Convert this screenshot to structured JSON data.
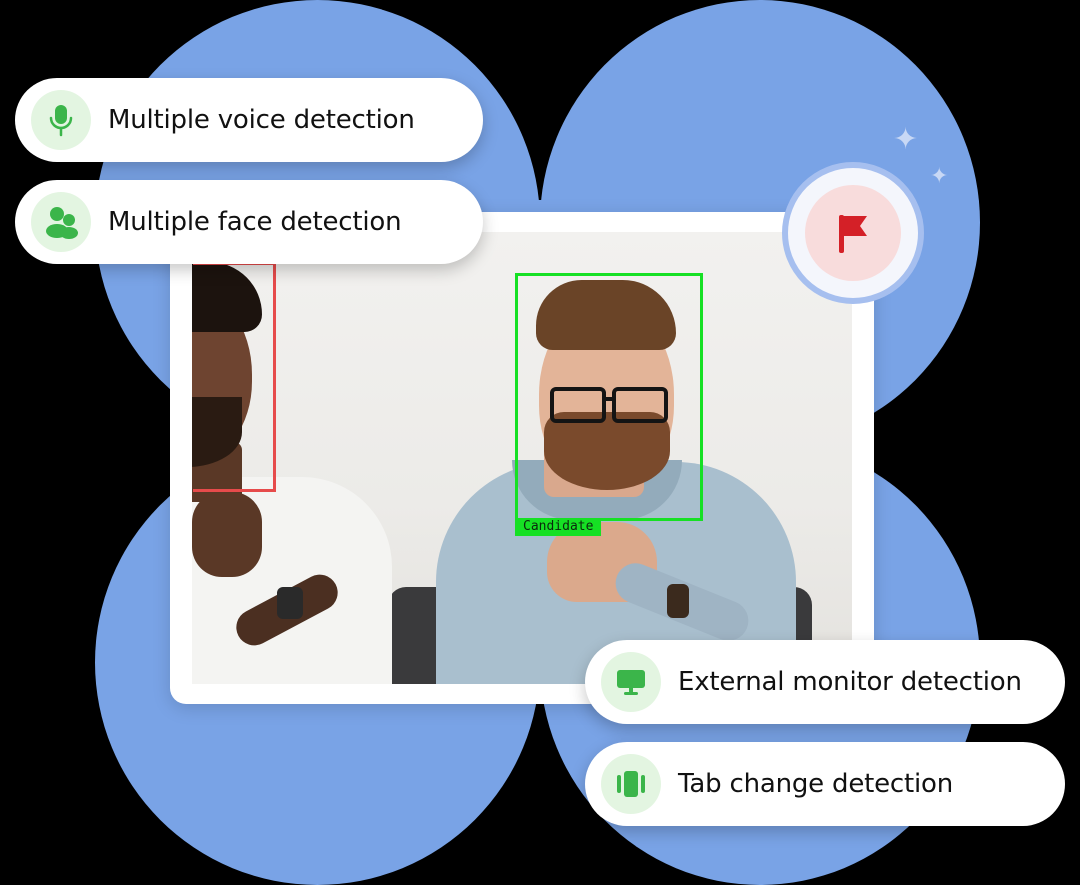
{
  "features": [
    {
      "label": "Multiple voice detection",
      "icon": "microphone-icon"
    },
    {
      "label": "Multiple face detection",
      "icon": "users-icon"
    },
    {
      "label": "External monitor detection",
      "icon": "monitor-icon"
    },
    {
      "label": "Tab change detection",
      "icon": "tab-switch-icon"
    }
  ],
  "video": {
    "candidate_label": "Candidate",
    "flag_icon": "flag-icon"
  },
  "colors": {
    "background_blob": "#79a3e6",
    "icon_green": "#3bb54a",
    "icon_bg": "#e3f5e1",
    "candidate_box": "#16e024",
    "other_face_box": "#e64b4b",
    "flag_red": "#d42027"
  }
}
